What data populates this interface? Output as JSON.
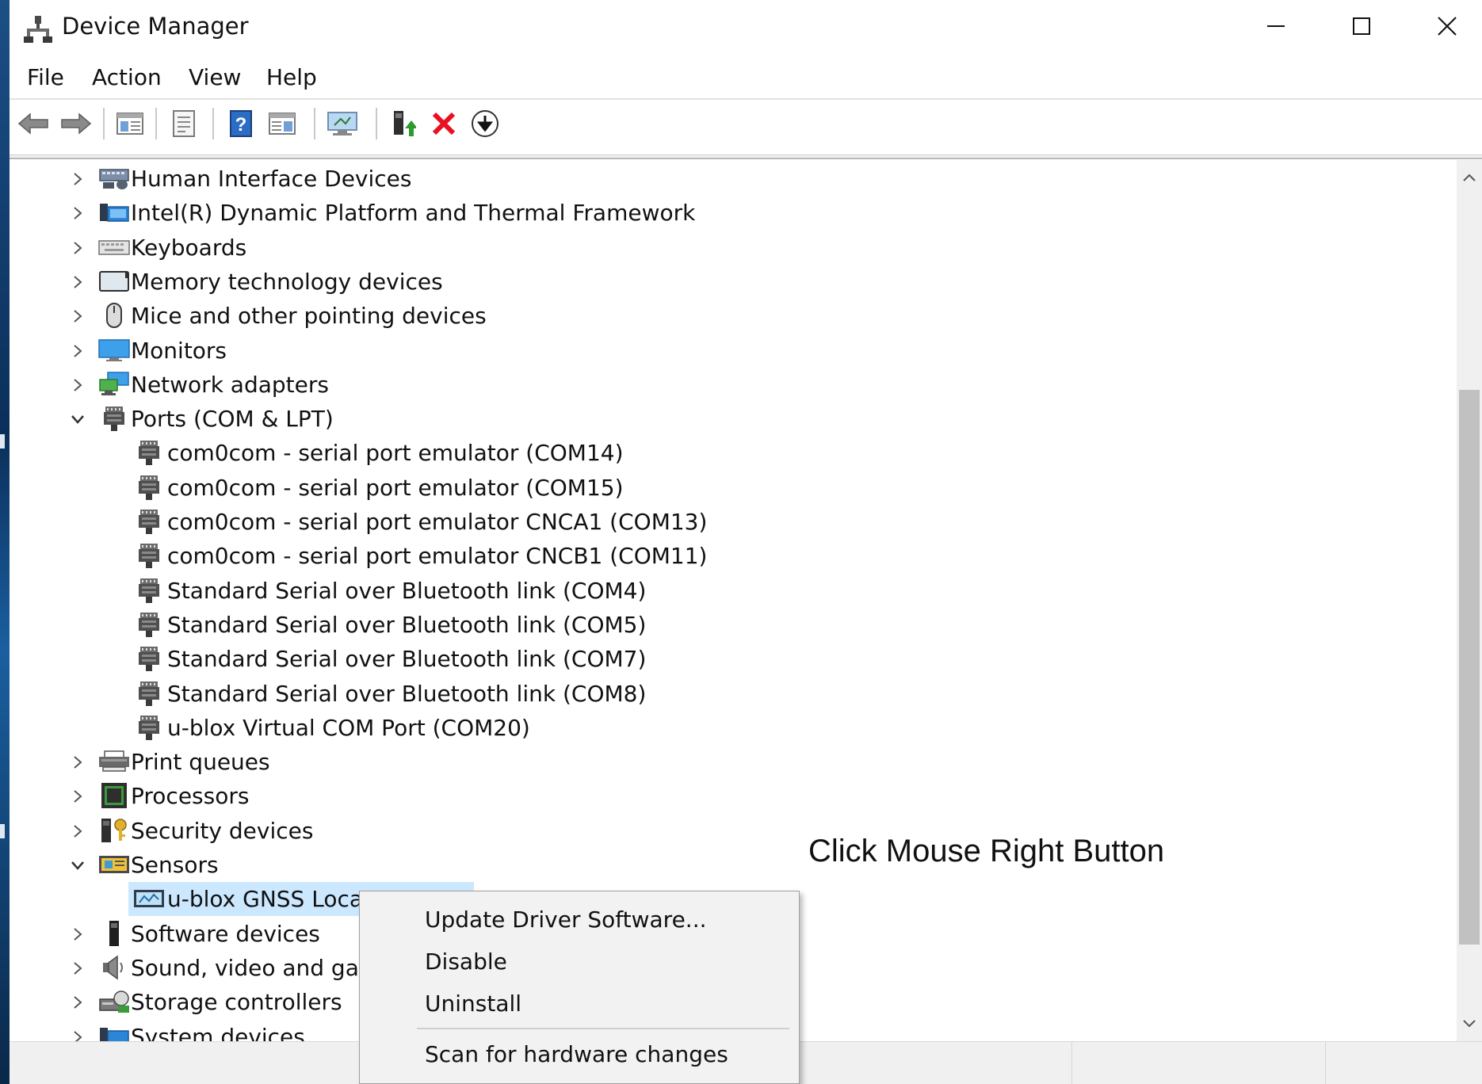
{
  "window": {
    "title": "Device Manager",
    "controls": {
      "minimize": "minimize-button",
      "maximize": "maximize-button",
      "close": "close-button"
    }
  },
  "menubar": {
    "items": [
      "File",
      "Action",
      "View",
      "Help"
    ]
  },
  "toolbar": {
    "buttons": [
      "back",
      "forward",
      "show-hide-console-tree",
      "properties",
      "help",
      "action-pane",
      "scan-for-changes",
      "update-driver",
      "uninstall",
      "disable"
    ]
  },
  "tree": {
    "categories": [
      {
        "label": "Human Interface Devices",
        "expanded": false,
        "icon": "hid-icon"
      },
      {
        "label": "Intel(R) Dynamic Platform and Thermal Framework",
        "expanded": false,
        "icon": "intel-dptf-icon"
      },
      {
        "label": "Keyboards",
        "expanded": false,
        "icon": "keyboard-icon"
      },
      {
        "label": "Memory technology devices",
        "expanded": false,
        "icon": "memory-icon"
      },
      {
        "label": "Mice and other pointing devices",
        "expanded": false,
        "icon": "mouse-icon"
      },
      {
        "label": "Monitors",
        "expanded": false,
        "icon": "monitor-icon"
      },
      {
        "label": "Network adapters",
        "expanded": false,
        "icon": "network-icon"
      },
      {
        "label": "Ports (COM & LPT)",
        "expanded": true,
        "icon": "port-icon"
      },
      {
        "label": "Print queues",
        "expanded": false,
        "icon": "printer-icon"
      },
      {
        "label": "Processors",
        "expanded": false,
        "icon": "processor-icon"
      },
      {
        "label": "Security devices",
        "expanded": false,
        "icon": "security-icon"
      },
      {
        "label": "Sensors",
        "expanded": true,
        "icon": "sensor-icon"
      },
      {
        "label": "Software devices",
        "expanded": false,
        "icon": "software-device-icon"
      },
      {
        "label": "Sound, video and gam",
        "expanded": false,
        "icon": "speaker-icon"
      },
      {
        "label": "Storage controllers",
        "expanded": false,
        "icon": "storage-icon"
      },
      {
        "label": "System devices",
        "expanded": false,
        "icon": "system-folder-icon"
      }
    ],
    "ports": [
      "com0com - serial port emulator (COM14)",
      "com0com - serial port emulator (COM15)",
      "com0com - serial port emulator CNCA1 (COM13)",
      "com0com - serial port emulator CNCB1 (COM11)",
      "Standard Serial over Bluetooth link (COM4)",
      "Standard Serial over Bluetooth link (COM5)",
      "Standard Serial over Bluetooth link (COM7)",
      "Standard Serial over Bluetooth link (COM8)",
      "u-blox Virtual COM Port (COM20)"
    ],
    "sensors": [
      {
        "label": "u-blox GNSS Locat",
        "selected": true
      }
    ]
  },
  "context_menu": {
    "items": [
      "Update Driver Software...",
      "Disable",
      "Uninstall",
      "Scan for hardware changes"
    ]
  },
  "annotation": "Click Mouse Right Button",
  "colors": {
    "selection": "#cce8ff",
    "accent_red": "#e81123",
    "icon_green": "#2d9b2d",
    "icon_blue": "#2b6cc4"
  }
}
